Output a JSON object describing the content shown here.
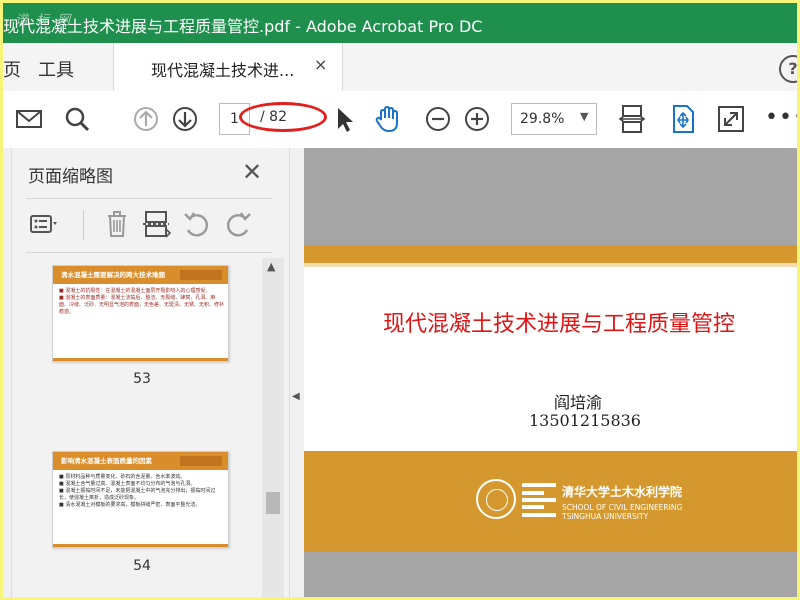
{
  "window": {
    "title": "现代混凝土技术进展与工程质量管控.pdf - Adobe Acrobat Pro DC",
    "watermark": "谱 标 网"
  },
  "tabs": {
    "home": "页",
    "tools": "工具",
    "document": "现代混凝土技术进...",
    "close": "×",
    "help": "?"
  },
  "toolbar": {
    "current_page": "1",
    "total_pages": "/ 82",
    "zoom": "29.8%",
    "zoom_arrow": "▼",
    "more": "•••"
  },
  "thumbnails_panel": {
    "title": "页面缩略图",
    "close": "✕",
    "scroll_up": "▲",
    "collapse": "◀",
    "items": [
      {
        "page": "53",
        "heading": "清水混凝土需要解决的两大技术难题",
        "lines": [
          "■ 混凝土的抗裂性：在混凝土的混凝土面层开裂影响人的心理感受。",
          "■ 混凝土的表面质量：混凝土浇捣后、整洁、无裂缝、蜂窝、孔洞、麻面、冷缝、泛砂、无明显气泡的表面，无色差、无斑渍、无锈、无积、修补痕迹。"
        ]
      },
      {
        "page": "54",
        "heading": "影响清水混凝土表面质量的因素",
        "lines": [
          "■ 原材料品种与质量变化、砂石的含泥量、含水率波动。",
          "■ 混凝土含气量过高、混凝土表面不均匀分布的气泡与孔洞。",
          "■ 混凝土振捣时间不足，未能把混凝土中的气泡充分排出；振捣时间过长，使混凝土离析，造成泛砂现象。",
          "■ 清水混凝土对模板的要求高，模板拼缝严密、表面平整光洁。"
        ]
      }
    ]
  },
  "slide": {
    "title": "现代混凝土技术进展与工程质量管控",
    "author": "阎培渝",
    "phone": "13501215836",
    "logo_cn": "清华大学土木水利学院",
    "logo_en1": "SCHOOL OF CIVIL ENGINEERING",
    "logo_en2": "TSINGHUA UNIVERSITY"
  },
  "colors": {
    "titlebar": "#1f8f4d",
    "accent_orange": "#d4982e",
    "slide_title_red": "#e01515",
    "highlight_circle": "#e0201c",
    "acrobat_blue": "#1a73c8"
  }
}
